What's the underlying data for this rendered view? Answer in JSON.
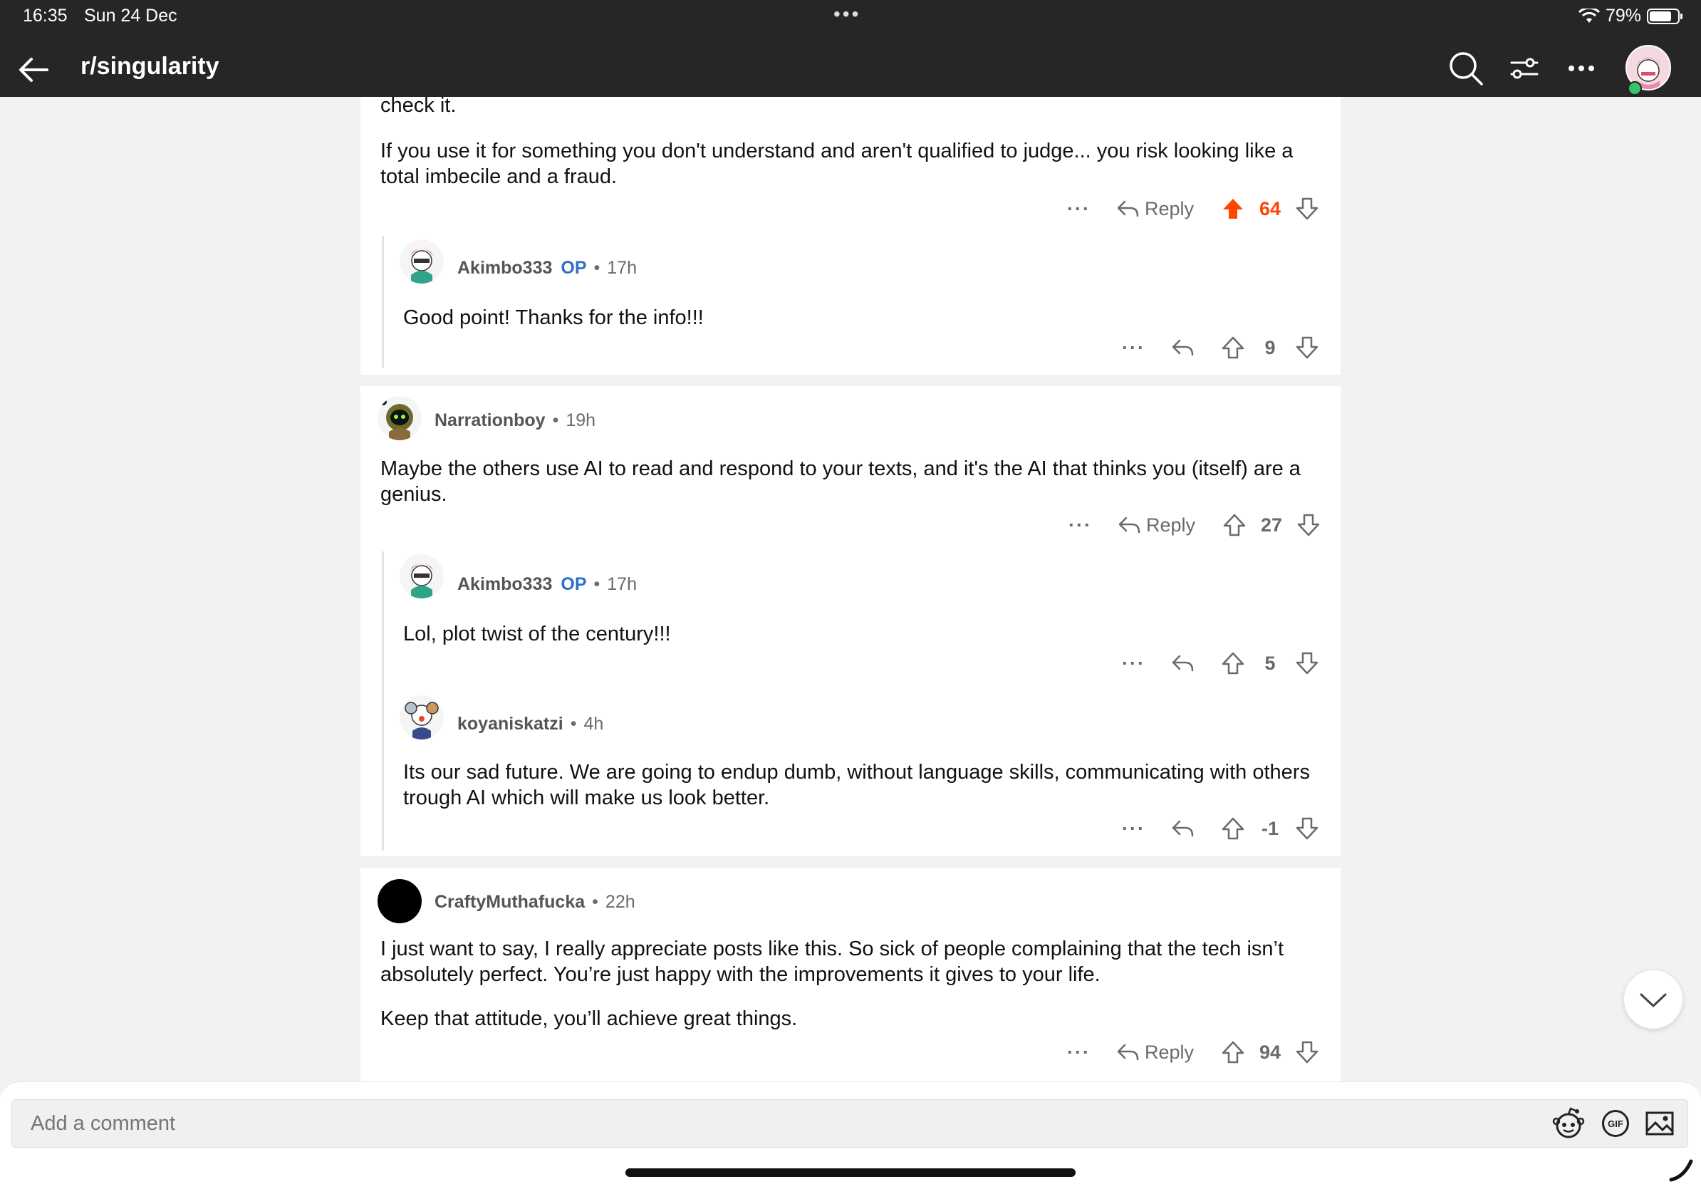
{
  "status": {
    "time": "16:35",
    "date": "Sun 24 Dec",
    "battery": "79%",
    "battery_level": 0.79
  },
  "nav": {
    "title": "r/singularity"
  },
  "comments": {
    "c1": {
      "text_top": "check it.",
      "text": "If you use it for something you don't understand and aren't qualified to judge... you risk looking like a total imbecile and a fraud.",
      "reply": "Reply",
      "score": "64",
      "upvoted": true
    },
    "c1r1": {
      "user": "Akimbo333",
      "op": "OP",
      "time": "17h",
      "text": "Good point! Thanks for the info!!!",
      "score": "9"
    },
    "c2": {
      "user": "Narrationboy",
      "time": "19h",
      "text": "Maybe the others use AI to read and respond to your texts, and it's the AI that thinks you (itself) are a genius.",
      "reply": "Reply",
      "score": "27"
    },
    "c2r1": {
      "user": "Akimbo333",
      "op": "OP",
      "time": "17h",
      "text": "Lol, plot twist of the century!!!",
      "score": "5"
    },
    "c2r2": {
      "user": "koyaniskatzi",
      "time": "4h",
      "text": "Its our sad future. We are going to endup dumb, without language skills, communicating with others trough AI which will make us look better.",
      "score": "-1"
    },
    "c3": {
      "user": "CraftyMuthafucka",
      "time": "22h",
      "text1": "I just want to say, I really appreciate posts like this.  So sick of people complaining that the tech isn’t absolutely perfect.  You’re just happy with the improvements it gives to your life.",
      "text2": "Keep that attitude, you’ll achieve great things.",
      "reply": "Reply",
      "score": "94"
    }
  },
  "composer": {
    "placeholder": "Add a comment",
    "gif_label": "GIF"
  },
  "colors": {
    "upvote": "#ff4500",
    "op": "#2f6ec6",
    "header": "#262626"
  }
}
